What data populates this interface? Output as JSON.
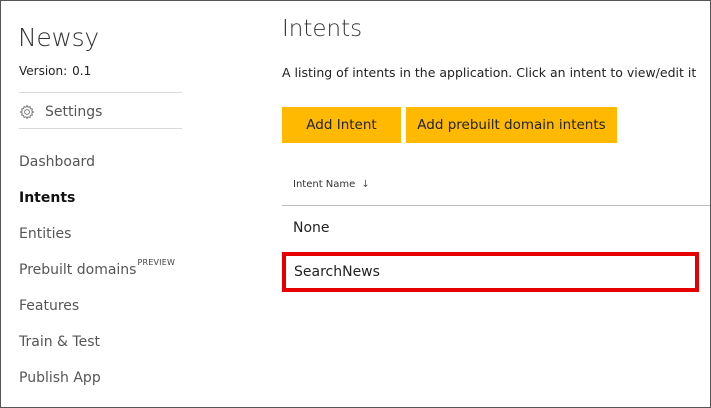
{
  "app": {
    "name": "Newsy",
    "version_label": "Version:",
    "version_value": "0.1"
  },
  "sidebar": {
    "settings_label": "Settings",
    "settings_icon": "gear-icon",
    "items": [
      {
        "label": "Dashboard",
        "active": false
      },
      {
        "label": "Intents",
        "active": true
      },
      {
        "label": "Entities",
        "active": false
      },
      {
        "label": "Prebuilt domains",
        "badge": "PREVIEW",
        "active": false
      },
      {
        "label": "Features",
        "active": false
      },
      {
        "label": "Train & Test",
        "active": false
      },
      {
        "label": "Publish App",
        "active": false
      }
    ]
  },
  "main": {
    "title": "Intents",
    "description": "A listing of intents in the application. Click an intent to view/edit it",
    "buttons": {
      "add_intent": "Add Intent",
      "add_prebuilt": "Add prebuilt domain intents"
    },
    "table": {
      "column_header": "Intent Name",
      "sort_indicator": "↓",
      "rows": [
        "None",
        "SearchNews"
      ],
      "highlighted_row": "SearchNews"
    }
  },
  "colors": {
    "accent": "#ffb900",
    "highlight": "#e60000"
  }
}
